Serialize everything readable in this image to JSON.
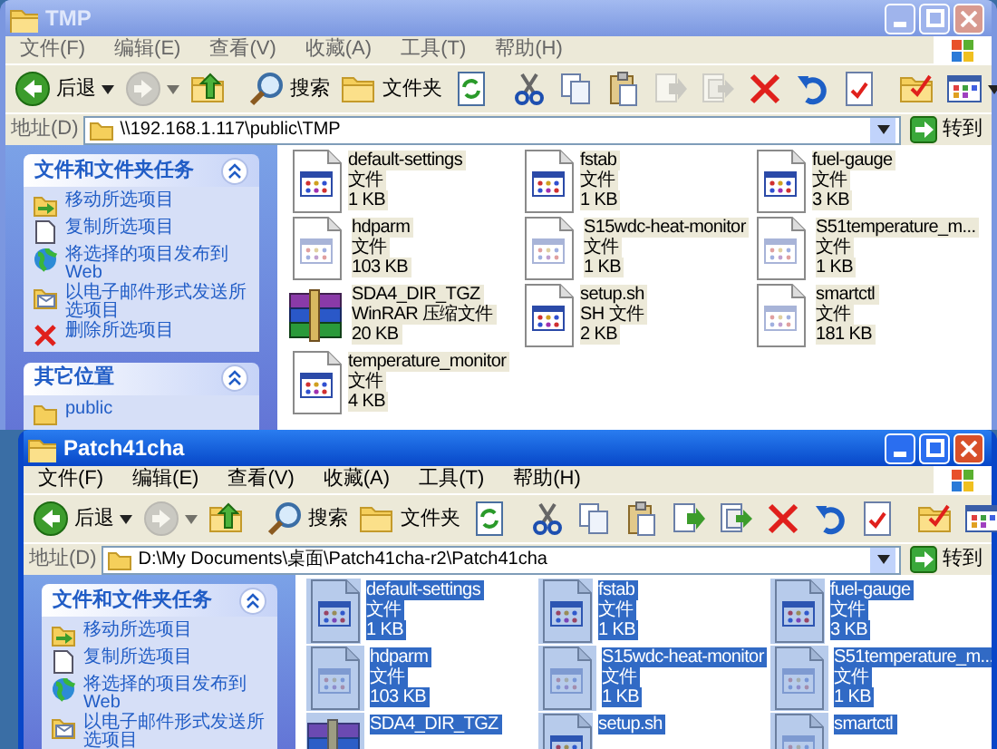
{
  "windows": [
    {
      "title": "TMP",
      "active": false,
      "menu": [
        "文件(F)",
        "编辑(E)",
        "查看(V)",
        "收藏(A)",
        "工具(T)",
        "帮助(H)"
      ],
      "toolbar": [
        {
          "kind": "back",
          "label": "后退",
          "disabled": false
        },
        {
          "kind": "forward",
          "disabled": true
        },
        {
          "kind": "up",
          "disabled": false
        },
        {
          "kind": "search",
          "label": "搜索",
          "disabled": false
        },
        {
          "kind": "folders",
          "label": "文件夹",
          "disabled": false
        },
        {
          "kind": "sync",
          "disabled": false
        },
        {
          "kind": "cut",
          "disabled": false
        },
        {
          "kind": "copy",
          "disabled": false
        },
        {
          "kind": "paste",
          "disabled": false
        },
        {
          "kind": "move_to",
          "disabled": true
        },
        {
          "kind": "copy_to",
          "disabled": true
        },
        {
          "kind": "delete",
          "disabled": false
        },
        {
          "kind": "undo",
          "disabled": false
        },
        {
          "kind": "properties",
          "disabled": false
        },
        {
          "kind": "folder_check",
          "disabled": false
        },
        {
          "kind": "views",
          "disabled": false
        }
      ],
      "address": {
        "label": "地址(D)",
        "value": "\\\\192.168.1.117\\public\\TMP",
        "go": "转到"
      },
      "panels": [
        {
          "title": "文件和文件夹任务",
          "items": [
            {
              "kind": "move",
              "text": "移动所选项目"
            },
            {
              "kind": "copy",
              "text": "复制所选项目"
            },
            {
              "kind": "publish",
              "text": "将选择的项目发布到 Web"
            },
            {
              "kind": "email",
              "text": "以电子邮件形式发送所选项目"
            },
            {
              "kind": "delete",
              "text": "删除所选项目"
            }
          ]
        },
        {
          "title": "其它位置",
          "items": [
            {
              "kind": "folder",
              "text": "public"
            }
          ]
        }
      ],
      "files": [
        {
          "kind": "program",
          "name": "default-settings",
          "type": "文件",
          "size": "1 KB",
          "selected": true
        },
        {
          "kind": "program",
          "name": "fstab",
          "type": "文件",
          "size": "1 KB",
          "selected": true
        },
        {
          "kind": "program",
          "name": "fuel-gauge",
          "type": "文件",
          "size": "3 KB",
          "selected": true
        },
        {
          "kind": "file",
          "name": "hdparm",
          "type": "文件",
          "size": "103 KB",
          "selected": true
        },
        {
          "kind": "file",
          "name": "S15wdc-heat-monitor",
          "type": "文件",
          "size": "1 KB",
          "selected": true
        },
        {
          "kind": "file",
          "name": "S51temperature_m...",
          "type": "文件",
          "size": "1 KB",
          "selected": true
        },
        {
          "kind": "archive",
          "name": "SDA4_DIR_TGZ",
          "type": "WinRAR 压缩文件",
          "size": "20 KB",
          "selected": true
        },
        {
          "kind": "program",
          "name": "setup.sh",
          "type": "SH 文件",
          "size": "2 KB",
          "selected": true
        },
        {
          "kind": "file",
          "name": "smartctl",
          "type": "文件",
          "size": "181 KB",
          "selected": true
        },
        {
          "kind": "program",
          "name": "temperature_monitor",
          "type": "文件",
          "size": "4 KB",
          "selected": true
        }
      ]
    },
    {
      "title": "Patch41cha",
      "active": true,
      "menu": [
        "文件(F)",
        "编辑(E)",
        "查看(V)",
        "收藏(A)",
        "工具(T)",
        "帮助(H)"
      ],
      "toolbar": [
        {
          "kind": "back",
          "label": "后退",
          "disabled": false
        },
        {
          "kind": "forward",
          "disabled": true
        },
        {
          "kind": "up",
          "disabled": false
        },
        {
          "kind": "search",
          "label": "搜索",
          "disabled": false
        },
        {
          "kind": "folders",
          "label": "文件夹",
          "disabled": false
        },
        {
          "kind": "sync",
          "disabled": false
        },
        {
          "kind": "cut",
          "disabled": false
        },
        {
          "kind": "copy",
          "disabled": false
        },
        {
          "kind": "paste",
          "disabled": false
        },
        {
          "kind": "move_to",
          "disabled": false
        },
        {
          "kind": "copy_to",
          "disabled": false
        },
        {
          "kind": "delete",
          "disabled": false
        },
        {
          "kind": "undo",
          "disabled": false
        },
        {
          "kind": "properties",
          "disabled": false
        },
        {
          "kind": "folder_check",
          "disabled": false
        },
        {
          "kind": "views",
          "disabled": false
        }
      ],
      "address": {
        "label": "地址(D)",
        "value": "D:\\My Documents\\桌面\\Patch41cha-r2\\Patch41cha",
        "go": "转到"
      },
      "panels": [
        {
          "title": "文件和文件夹任务",
          "items": [
            {
              "kind": "move",
              "text": "移动所选项目"
            },
            {
              "kind": "copy",
              "text": "复制所选项目"
            },
            {
              "kind": "publish",
              "text": "将选择的项目发布到 Web"
            },
            {
              "kind": "email",
              "text": "以电子邮件形式发送所选项目"
            }
          ]
        }
      ],
      "files": [
        {
          "kind": "program",
          "name": "default-settings",
          "type": "文件",
          "size": "1 KB",
          "selected": true
        },
        {
          "kind": "program",
          "name": "fstab",
          "type": "文件",
          "size": "1 KB",
          "selected": true
        },
        {
          "kind": "program",
          "name": "fuel-gauge",
          "type": "文件",
          "size": "3 KB",
          "selected": true
        },
        {
          "kind": "file",
          "name": "hdparm",
          "type": "文件",
          "size": "103 KB",
          "selected": true
        },
        {
          "kind": "file",
          "name": "S15wdc-heat-monitor",
          "type": "文件",
          "size": "1 KB",
          "selected": true
        },
        {
          "kind": "file",
          "name": "S51temperature_m...",
          "type": "文件",
          "size": "1 KB",
          "selected": true
        },
        {
          "kind": "archive",
          "name": "SDA4_DIR_TGZ",
          "selected": true
        },
        {
          "kind": "program",
          "name": "setup.sh",
          "selected": true
        },
        {
          "kind": "file",
          "name": "smartctl",
          "selected": true
        }
      ]
    }
  ]
}
